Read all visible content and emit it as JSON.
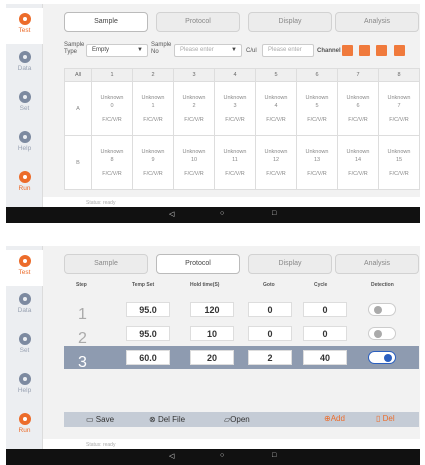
{
  "screen1": {
    "nav": [
      {
        "label": "Test",
        "icon": "test-icon"
      },
      {
        "label": "Data",
        "icon": "data-icon"
      },
      {
        "label": "Set",
        "icon": "settings-icon"
      },
      {
        "label": "Help",
        "icon": "help-icon"
      },
      {
        "label": "Run",
        "icon": "run-icon"
      }
    ],
    "tabs": [
      "Sample",
      "Protocol",
      "Display",
      "Analysis"
    ],
    "selected_tab": "Sample",
    "controls": {
      "sample_type_label": "Sample Type",
      "sample_type_value": "Empty",
      "sample_no_label": "Sample No",
      "sample_no_placeholder": "Please enter",
      "ct_label": "C/ul",
      "ct_placeholder": "Please enter",
      "channel_label": "Channel"
    },
    "grid": {
      "columns": [
        "All",
        "1",
        "2",
        "3",
        "4",
        "5",
        "6",
        "7",
        "8"
      ],
      "rows": [
        {
          "label": "A",
          "cells": [
            {
              "name": "Unknown",
              "id": "0",
              "channel": "F/C/V/R"
            },
            {
              "name": "Unknown",
              "id": "1",
              "channel": "F/C/V/R"
            },
            {
              "name": "Unknown",
              "id": "2",
              "channel": "F/C/V/R"
            },
            {
              "name": "Unknown",
              "id": "3",
              "channel": "F/C/V/R"
            },
            {
              "name": "Unknown",
              "id": "4",
              "channel": "F/C/V/R"
            },
            {
              "name": "Unknown",
              "id": "5",
              "channel": "F/C/V/R"
            },
            {
              "name": "Unknown",
              "id": "6",
              "channel": "F/C/V/R"
            },
            {
              "name": "Unknown",
              "id": "7",
              "channel": "F/C/V/R"
            }
          ]
        },
        {
          "label": "B",
          "cells": [
            {
              "name": "Unknown",
              "id": "8",
              "channel": "F/C/V/R"
            },
            {
              "name": "Unknown",
              "id": "9",
              "channel": "F/C/V/R"
            },
            {
              "name": "Unknown",
              "id": "10",
              "channel": "F/C/V/R"
            },
            {
              "name": "Unknown",
              "id": "11",
              "channel": "F/C/V/R"
            },
            {
              "name": "Unknown",
              "id": "12",
              "channel": "F/C/V/R"
            },
            {
              "name": "Unknown",
              "id": "13",
              "channel": "F/C/V/R"
            },
            {
              "name": "Unknown",
              "id": "14",
              "channel": "F/C/V/R"
            },
            {
              "name": "Unknown",
              "id": "15",
              "channel": "F/C/V/R"
            }
          ]
        }
      ]
    },
    "status": "Status: ready",
    "navbar": {
      "back": "◁",
      "home": "○",
      "recent": "□"
    }
  },
  "screen2": {
    "nav": [
      {
        "label": "Test",
        "icon": "test-icon"
      },
      {
        "label": "Data",
        "icon": "data-icon"
      },
      {
        "label": "Set",
        "icon": "settings-icon"
      },
      {
        "label": "Help",
        "icon": "help-icon"
      },
      {
        "label": "Run",
        "icon": "run-icon"
      }
    ],
    "tabs": [
      "Sample",
      "Protocol",
      "Display",
      "Analysis"
    ],
    "selected_tab": "Protocol",
    "headers": [
      "Step",
      "Temp Set",
      "Hold time(S)",
      "Goto",
      "Cycle",
      "Detection"
    ],
    "rows": [
      {
        "step": "1",
        "temp": "95.0",
        "hold": "120",
        "goto": "0",
        "cycle": "0",
        "detection": false
      },
      {
        "step": "2",
        "temp": "95.0",
        "hold": "10",
        "goto": "0",
        "cycle": "0",
        "detection": false
      },
      {
        "step": "3",
        "temp": "60.0",
        "hold": "20",
        "goto": "2",
        "cycle": "40",
        "detection": true
      }
    ],
    "toolbar": {
      "save": "Save",
      "del_file": "Del File",
      "open": "Open",
      "add": "Add",
      "del": "Del"
    },
    "status": "Status: ready",
    "navbar": {
      "back": "◁",
      "home": "○",
      "recent": "□"
    }
  },
  "accent_color": "#ec6c2b",
  "highlight_row_color": "#8e9bb0"
}
